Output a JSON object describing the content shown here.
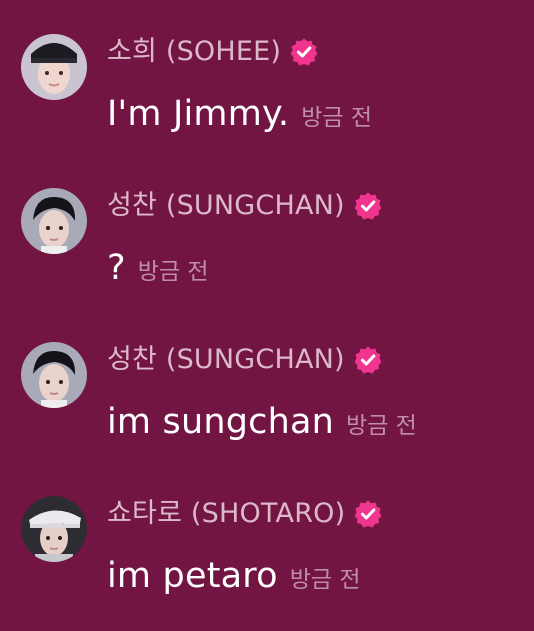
{
  "messages": [
    {
      "name": "소희 (SOHEE)",
      "text": "I'm Jimmy.",
      "time": "방금 전",
      "verified": true,
      "avatar": "sohee-avatar"
    },
    {
      "name": "성찬 (SUNGCHAN)",
      "text": "?",
      "time": "방금 전",
      "verified": true,
      "avatar": "sungchan-avatar"
    },
    {
      "name": "성찬 (SUNGCHAN)",
      "text": "im sungchan",
      "time": "방금 전",
      "verified": true,
      "avatar": "sungchan-avatar"
    },
    {
      "name": "쇼타로 (SHOTARO)",
      "text": "im petaro",
      "time": "방금 전",
      "verified": true,
      "avatar": "shotaro-avatar"
    }
  ],
  "colors": {
    "background": "#731543",
    "name": "#dcb9c9",
    "text": "#ffffff",
    "time": "#bf8ea7",
    "verified_badge": "#f0358e"
  },
  "icons": {
    "verified": "verified-badge-icon"
  }
}
